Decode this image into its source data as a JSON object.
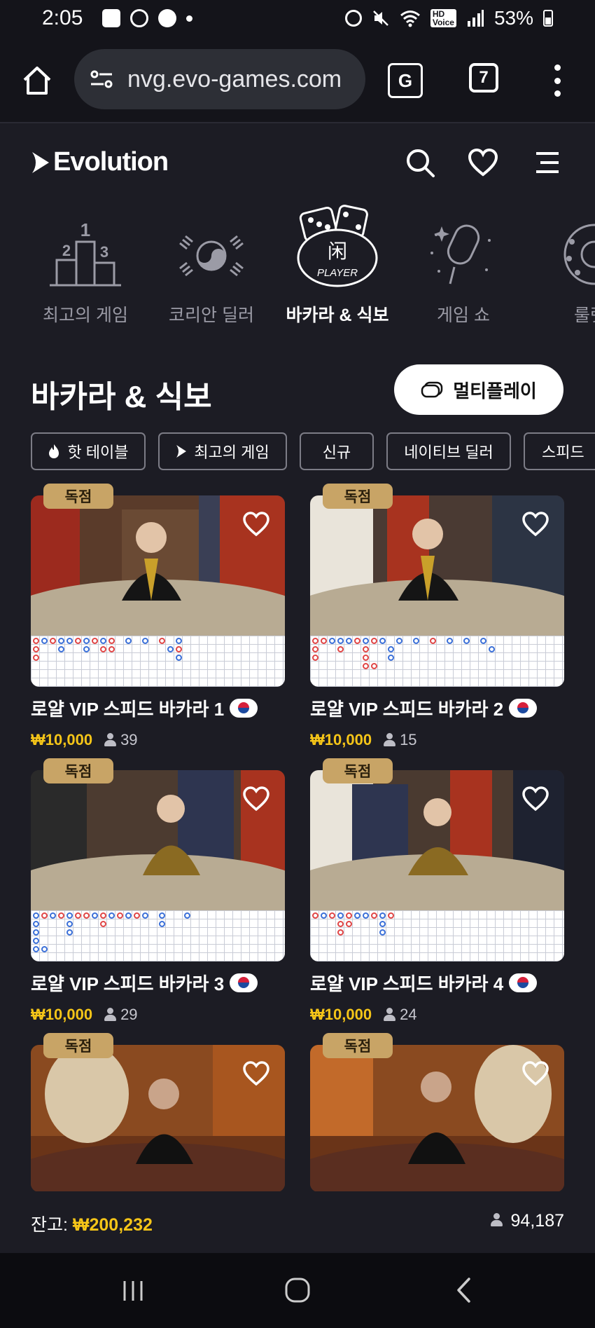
{
  "status_bar": {
    "time": "2:05",
    "battery": "53%",
    "icons": [
      "notification-b-icon",
      "app-icon",
      "chat-icon",
      "alarm-icon",
      "mute-icon",
      "wifi-icon",
      "hd-voice-icon",
      "signal-icon",
      "battery-icon"
    ]
  },
  "browser": {
    "url": "nvg.evo-games.com",
    "tab_count": "7",
    "translate_label": "G"
  },
  "header": {
    "logo": "Evolution"
  },
  "categories": [
    {
      "label": "최고의 게임",
      "active": false
    },
    {
      "label": "코리안 딜러",
      "active": false
    },
    {
      "label": "바카라 & 식보",
      "active": true
    },
    {
      "label": "게임 쇼",
      "active": false
    },
    {
      "label": "룰렛",
      "active": false
    }
  ],
  "category_icon_text": {
    "player": "PLAYER",
    "cjk": "闲"
  },
  "page": {
    "title": "바카라 & 식보",
    "multiplay_label": "멀티플레이"
  },
  "filters": [
    {
      "label": "핫 테이블"
    },
    {
      "label": "최고의 게임"
    },
    {
      "label": "신규"
    },
    {
      "label": "네이티브 딜러"
    },
    {
      "label": "스피드"
    }
  ],
  "games": [
    {
      "badge": "독점",
      "title": "로얄 VIP 스피드 바카라 1",
      "price": "₩10,000",
      "players": "39"
    },
    {
      "badge": "독점",
      "title": "로얄 VIP 스피드 바카라 2",
      "price": "₩10,000",
      "players": "15"
    },
    {
      "badge": "독점",
      "title": "로얄 VIP 스피드 바카라 3",
      "price": "₩10,000",
      "players": "29"
    },
    {
      "badge": "독점",
      "title": "로얄 VIP 스피드 바카라 4",
      "price": "₩10,000",
      "players": "24"
    },
    {
      "badge": "독점",
      "title": "",
      "price": "",
      "players": ""
    },
    {
      "badge": "독점",
      "title": "",
      "price": "",
      "players": ""
    }
  ],
  "footer": {
    "balance_label": "잔고:",
    "balance_amount": "₩200,232",
    "online_count": "94,187"
  },
  "colors": {
    "background": "#1c1c24",
    "accent_gold": "#f5c518",
    "badge_gold": "#c8a466",
    "muted_text": "#9b9ba6"
  }
}
